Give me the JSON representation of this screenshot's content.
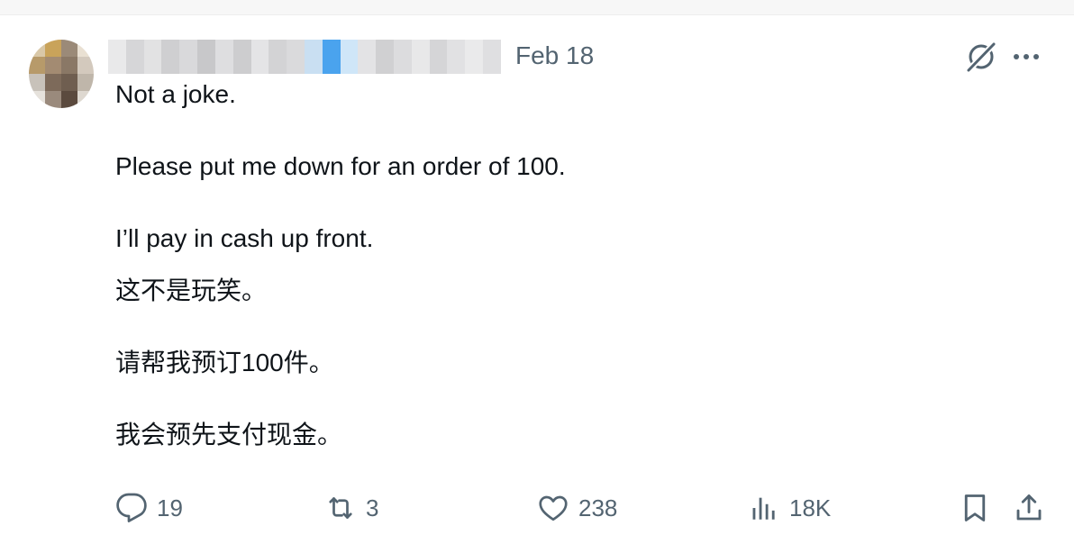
{
  "author": {
    "date": "Feb 18"
  },
  "tweet": {
    "lines": [
      "Not a joke.",
      "Please put me down for an order of 100.",
      "I’ll pay in cash up front.",
      "这不是玩笑。",
      "请帮我预订100件。",
      "我会预先支付现金。"
    ]
  },
  "actions": {
    "replies": "19",
    "retweets": "3",
    "likes": "238",
    "views": "18K"
  },
  "icons": {
    "grok": "grok-icon",
    "more": "more-icon",
    "reply": "reply-icon",
    "retweet": "retweet-icon",
    "like": "heart-icon",
    "views": "views-icon",
    "bookmark": "bookmark-icon",
    "share": "share-icon"
  },
  "colors": {
    "text": "#0f1419",
    "secondary": "#536471",
    "accent": "#1d9bf0"
  }
}
